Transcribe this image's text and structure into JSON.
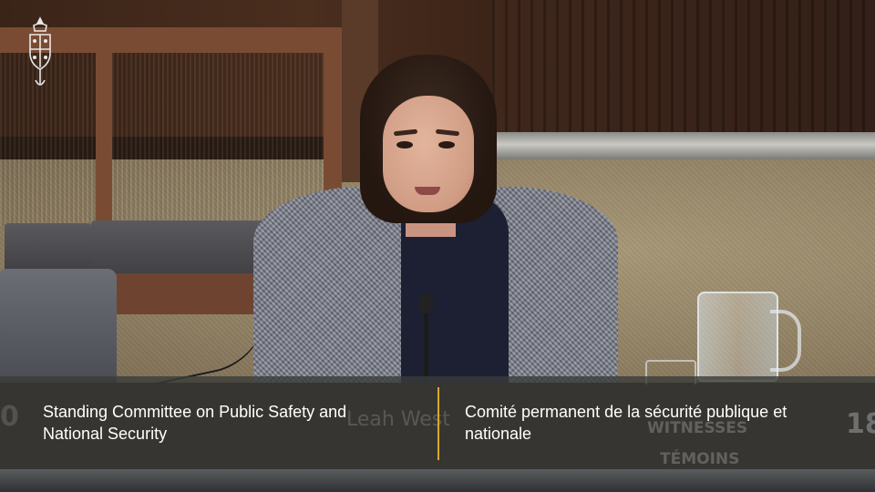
{
  "caption": {
    "english_line1": "Standing Committee on Public Safety and",
    "english_line2": "National Security",
    "french_line1": "Comité permanent de la sécurité publique et",
    "french_line2": "nationale",
    "divider_color": "#d7a829"
  },
  "background_text": {
    "nameplate": "Leah West",
    "witnesses": "WITNESSES",
    "temoins": "TÉMOINS",
    "seat_left": "0",
    "seat_right": "18"
  },
  "logo": {
    "icon": "house-of-commons-crest-icon"
  }
}
